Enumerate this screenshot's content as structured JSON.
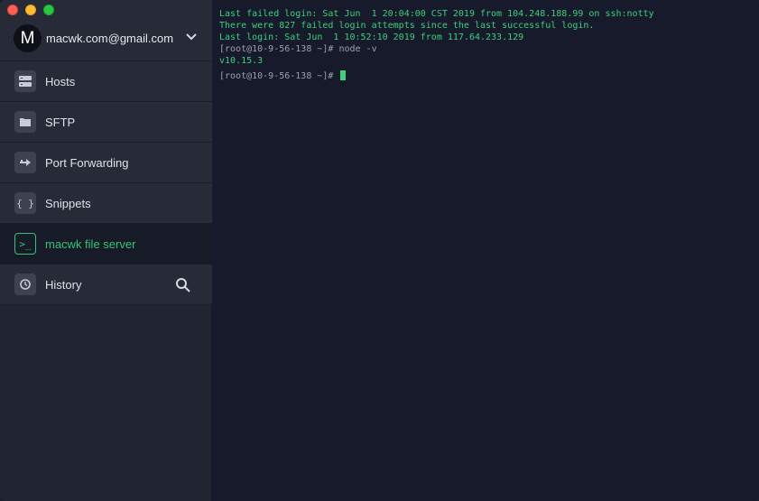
{
  "window": {
    "colors": {
      "accent": "#37c27a",
      "terminal_text": "#3fcf7e",
      "sidebar_bg": "#272b38",
      "terminal_bg": "#161a2a"
    }
  },
  "account": {
    "avatar_letter": "M",
    "email": "macwk.com@gmail.com",
    "chevron_icon": "chevron-down-icon"
  },
  "sidebar": {
    "items": [
      {
        "label": "Hosts",
        "icon": "hosts-icon",
        "glyph": "▤"
      },
      {
        "label": "SFTP",
        "icon": "folder-icon",
        "glyph": "▬"
      },
      {
        "label": "Port Forwarding",
        "icon": "port-forwarding-icon",
        "glyph": "⇛"
      },
      {
        "label": "Snippets",
        "icon": "snippets-icon",
        "glyph": "{ }"
      },
      {
        "label": "macwk file server",
        "icon": "terminal-icon",
        "glyph": ">_",
        "active": true
      },
      {
        "label": "History",
        "icon": "history-icon",
        "glyph": "⟲",
        "search_icon": "search-icon"
      }
    ]
  },
  "terminal": {
    "lines": [
      "Last failed login: Sat Jun  1 20:04:00 CST 2019 from 104.248.188.99 on ssh:notty",
      "There were 827 failed login attempts since the last successful login.",
      "Last login: Sat Jun  1 10:52:10 2019 from 117.64.233.129",
      "[root@10-9-56-138 ~]# node -v",
      "v10.15.3",
      "[root@10-9-56-138 ~]# "
    ]
  }
}
